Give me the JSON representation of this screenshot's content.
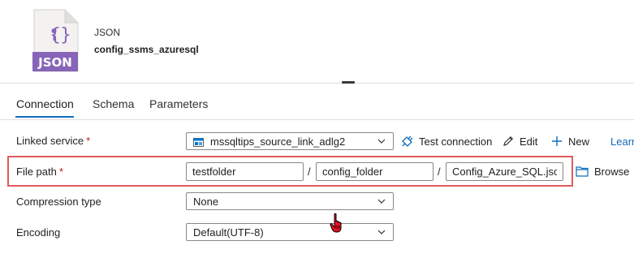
{
  "header": {
    "icon": "json-file-icon",
    "icon_badge": "JSON",
    "type_label": "JSON",
    "dataset_name": "config_ssms_azuresql"
  },
  "tabs": [
    {
      "label": "Connection",
      "active": true
    },
    {
      "label": "Schema",
      "active": false
    },
    {
      "label": "Parameters",
      "active": false
    }
  ],
  "form": {
    "linked_service": {
      "label": "Linked service",
      "required": "*",
      "value": "mssqltips_source_link_adlg2",
      "icon": "storage-icon",
      "actions": {
        "test_connection": "Test connection",
        "edit": "Edit",
        "new": "New",
        "learn": "Learn"
      }
    },
    "file_path": {
      "label": "File path",
      "required": "*",
      "container": "testfolder",
      "directory": "config_folder",
      "file": "Config_Azure_SQL.json",
      "separator": "/",
      "browse": "Browse",
      "highlight_color": "#e05b5b"
    },
    "compression_type": {
      "label": "Compression type",
      "value": "None"
    },
    "encoding": {
      "label": "Encoding",
      "value": "Default(UTF-8)"
    }
  },
  "colors": {
    "accent": "#0f6cbd",
    "json_badge": "#8764b8",
    "required": "#c50f1f"
  }
}
